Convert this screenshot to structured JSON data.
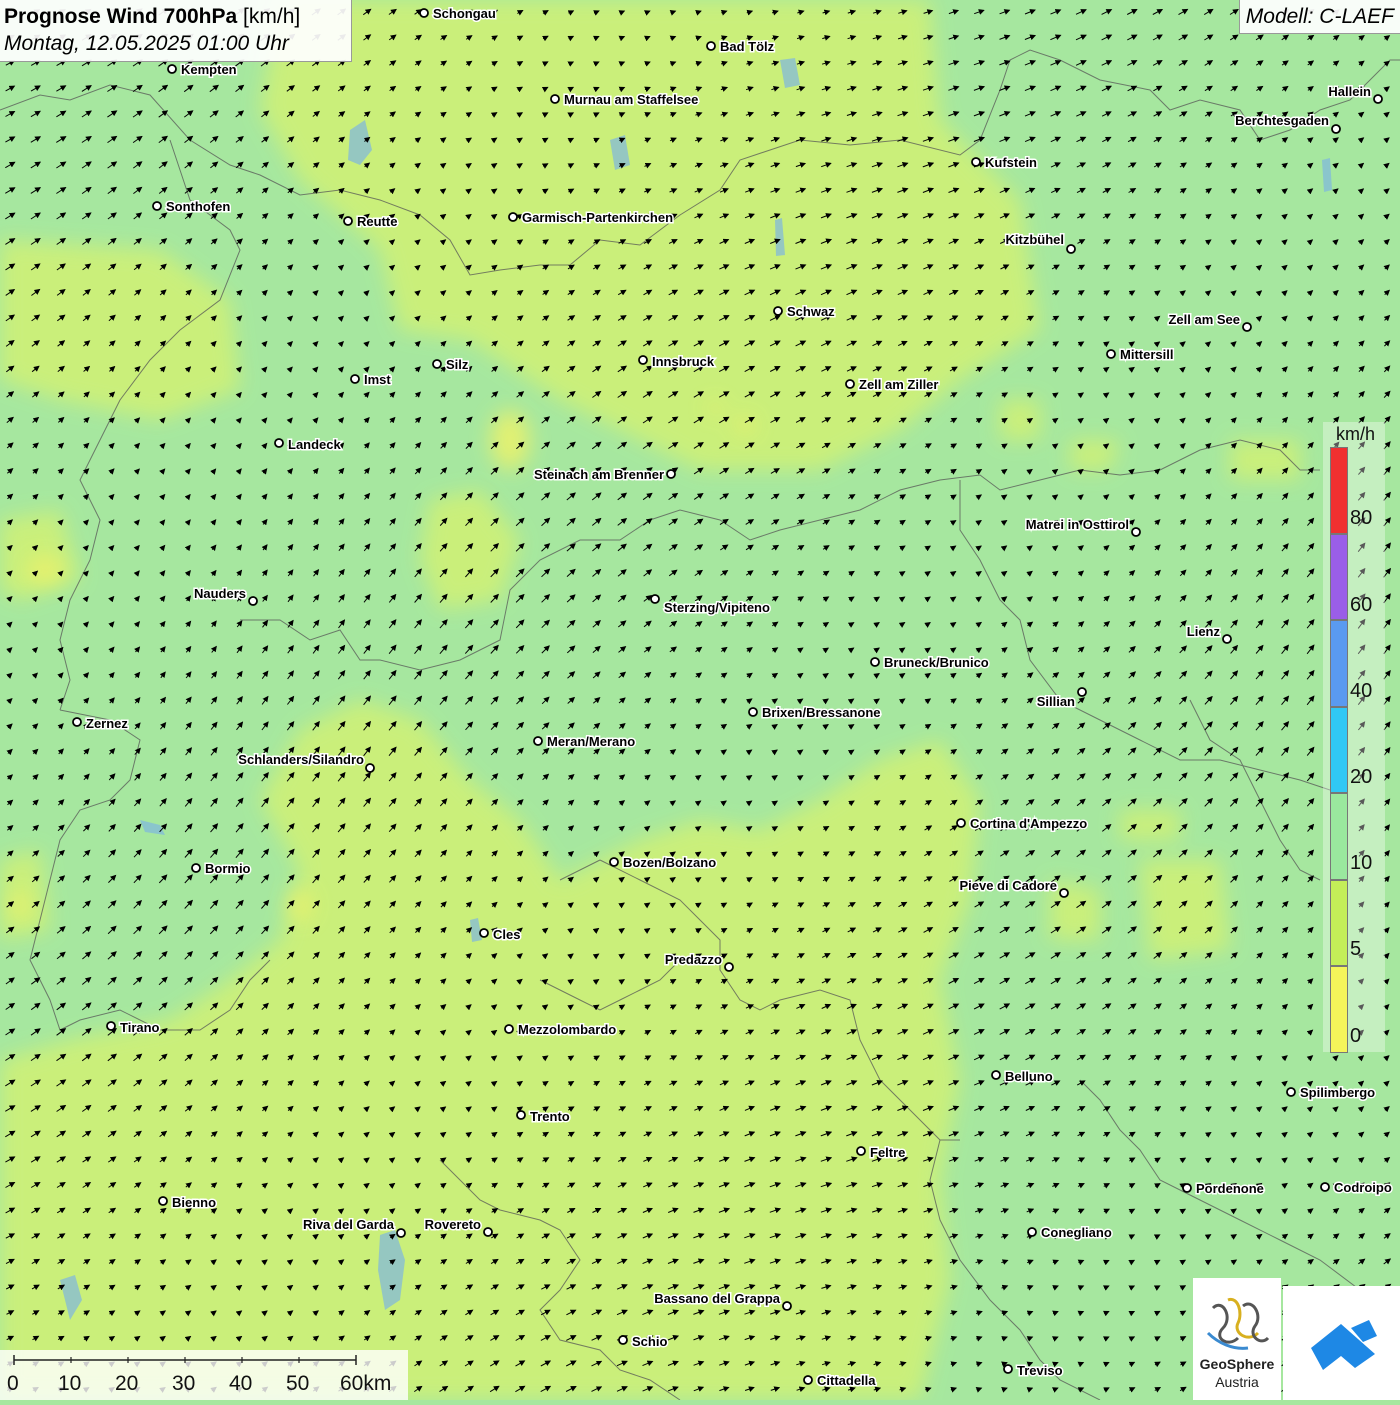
{
  "header": {
    "title_bold": "Prognose Wind 700hPa",
    "title_unit": "[km/h]",
    "datetime": "Montag, 12.05.2025 01:00 Uhr",
    "model": "Modell: C-LAEF"
  },
  "legend": {
    "unit": "km/h",
    "segments": [
      {
        "color": "#f03030"
      },
      {
        "color": "#9a5ee8"
      },
      {
        "color": "#5a9af0"
      },
      {
        "color": "#30c8f5"
      },
      {
        "color": "#9ae89e"
      },
      {
        "color": "#c4ee58"
      },
      {
        "color": "#f5f55a"
      }
    ],
    "labels": [
      "80",
      "60",
      "40",
      "20",
      "10",
      "5",
      "0"
    ]
  },
  "scale": {
    "labels": [
      "0",
      "10",
      "20",
      "30",
      "40",
      "50",
      "60km"
    ]
  },
  "logo": {
    "line1": "GeoSphere",
    "line2": "Austria"
  },
  "cities": [
    {
      "name": "Schongau"
    },
    {
      "name": "Bad Tölz"
    },
    {
      "name": "Kempten"
    },
    {
      "name": "Murnau am Staffelsee"
    },
    {
      "name": "Hallein"
    },
    {
      "name": "Berchtesgaden"
    },
    {
      "name": "Kufstein"
    },
    {
      "name": "Sonthofen"
    },
    {
      "name": "Reutte"
    },
    {
      "name": "Garmisch-Partenkirchen"
    },
    {
      "name": "Kitzbühel"
    },
    {
      "name": "Schwaz"
    },
    {
      "name": "Zell am See"
    },
    {
      "name": "Mittersill"
    },
    {
      "name": "Innsbruck"
    },
    {
      "name": "Silz"
    },
    {
      "name": "Imst"
    },
    {
      "name": "Zell am Ziller"
    },
    {
      "name": "Landeck"
    },
    {
      "name": "Steinach am Brenner"
    },
    {
      "name": "Matrei in Osttirol"
    },
    {
      "name": "Nauders"
    },
    {
      "name": "Sterzing/Vipiteno"
    },
    {
      "name": "Lienz"
    },
    {
      "name": "Bruneck/Brunico"
    },
    {
      "name": "Sillian"
    },
    {
      "name": "Zernez"
    },
    {
      "name": "Brixen/Bressanone"
    },
    {
      "name": "Meran/Merano"
    },
    {
      "name": "Schlanders/Silandro"
    },
    {
      "name": "Cortina d'Ampezzo"
    },
    {
      "name": "Bozen/Bolzano"
    },
    {
      "name": "Bormio"
    },
    {
      "name": "Pieve di Cadore"
    },
    {
      "name": "Cles"
    },
    {
      "name": "Predazzo"
    },
    {
      "name": "Tirano"
    },
    {
      "name": "Mezzolombardo"
    },
    {
      "name": "Belluno"
    },
    {
      "name": "Spilimbergo"
    },
    {
      "name": "Trento"
    },
    {
      "name": "Feltre"
    },
    {
      "name": "Pordenone"
    },
    {
      "name": "Codroipo"
    },
    {
      "name": "Bienno"
    },
    {
      "name": "Riva del Garda"
    },
    {
      "name": "Rovereto"
    },
    {
      "name": "Conegliano"
    },
    {
      "name": "Bassano del Grappa"
    },
    {
      "name": "Schio"
    },
    {
      "name": "Treviso"
    },
    {
      "name": "Cittadella"
    }
  ]
}
